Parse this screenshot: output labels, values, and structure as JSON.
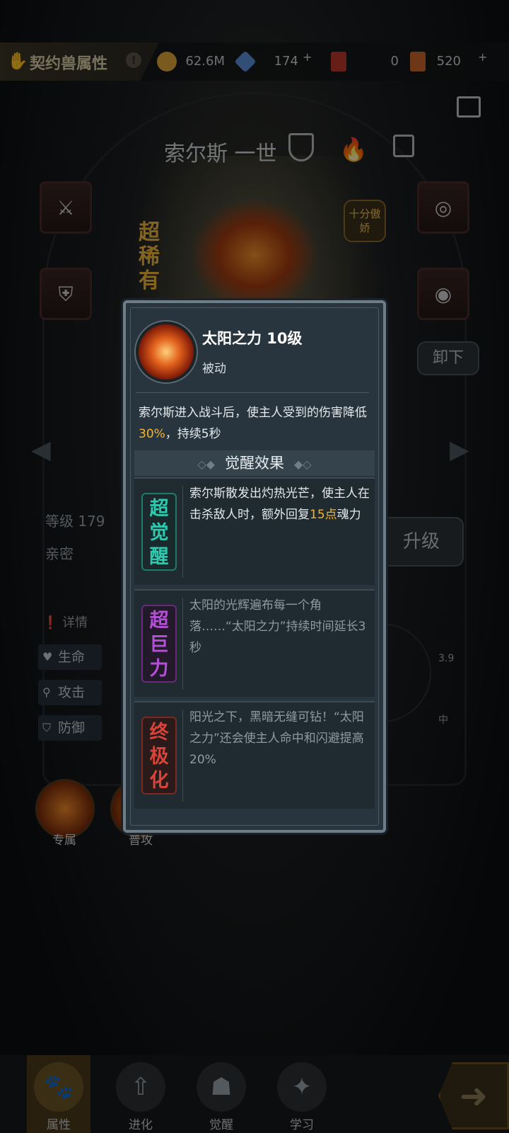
{
  "header": {
    "title": "契约兽属性",
    "resources": [
      {
        "name": "gold-coin",
        "value": "62.6M",
        "color": "#e0a43a"
      },
      {
        "name": "blue-crystal",
        "value": "174",
        "color": "#5a8fd8"
      },
      {
        "name": "red-card",
        "value": "0",
        "color": "#b83a2a"
      },
      {
        "name": "orange-card",
        "value": "520",
        "color": "#c8642a"
      }
    ]
  },
  "pet": {
    "name": "索尔斯 一世",
    "rarity": "超稀有",
    "trait": "十分傲娇",
    "unequip_label": "卸下",
    "level_label": "等级 179",
    "intimacy_label": "亲密",
    "upgrade_label": "升级",
    "detail_label": "详情",
    "stats": [
      "生命",
      "攻击",
      "防御"
    ],
    "side_values": [
      "3.9",
      "中"
    ],
    "skill_tabs": [
      "专属",
      "普攻"
    ]
  },
  "popup": {
    "skill_name": "太阳之力 10级",
    "skill_type": "被动",
    "desc_pre": "索尔斯进入战斗后，使主人受到的伤害降低",
    "desc_hl": "30%",
    "desc_post": "，持续5秒",
    "awake_title": "觉醒效果",
    "awakenings": [
      {
        "badge": "超觉醒",
        "text_pre": "索尔斯散发出灼热光芒，使主人在击杀敌人时，额外回复",
        "text_hl": "15点",
        "text_post": "魂力",
        "color": "#2fc9b0"
      },
      {
        "badge": "超巨力",
        "text_pre": "太阳的光辉遍布每一个角落……“太阳之力”持续时间延长3秒",
        "text_hl": "",
        "text_post": "",
        "color": "#b64fd8"
      },
      {
        "badge": "终极化",
        "text_pre": "阳光之下，黑暗无缝可钻！“太阳之力”还会使主人命中和闪避提高20%",
        "text_hl": "",
        "text_post": "",
        "color": "#d6443a"
      }
    ]
  },
  "nav": {
    "items": [
      "属性",
      "进化",
      "觉醒",
      "学习"
    ]
  }
}
